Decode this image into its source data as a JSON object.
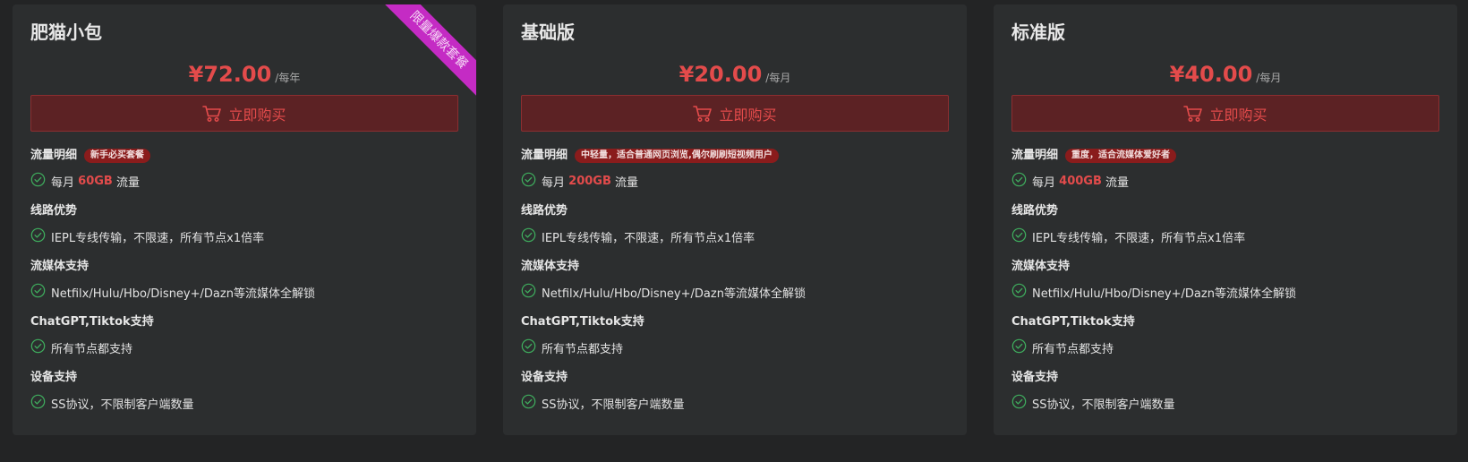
{
  "buy_label": "立即购买",
  "plans": [
    {
      "name": "肥猫小包",
      "price": "¥72.00",
      "period": "/每年",
      "ribbon": "限量爆款套餐",
      "traffic_title": "流量明细",
      "traffic_tag": "新手必买套餐",
      "traffic_prefix": "每月",
      "traffic_amount": "60GB",
      "traffic_suffix": "流量",
      "route_title": "线路优势",
      "route_text": "IEPL专线传输，不限速，所有节点x1倍率",
      "stream_title": "流媒体支持",
      "stream_text": "Netfilx/Hulu/Hbo/Disney+/Dazn等流媒体全解锁",
      "ai_title": "ChatGPT,Tiktok支持",
      "ai_text": "所有节点都支持",
      "device_title": "设备支持",
      "device_text": "SS协议，不限制客户端数量"
    },
    {
      "name": "基础版",
      "price": "¥20.00",
      "period": "/每月",
      "traffic_title": "流量明细",
      "traffic_tag": "中轻量，适合普通网页浏览,偶尔刷刷短视频用户",
      "traffic_prefix": "每月",
      "traffic_amount": "200GB",
      "traffic_suffix": "流量",
      "route_title": "线路优势",
      "route_text": "IEPL专线传输，不限速，所有节点x1倍率",
      "stream_title": "流媒体支持",
      "stream_text": "Netfilx/Hulu/Hbo/Disney+/Dazn等流媒体全解锁",
      "ai_title": "ChatGPT,Tiktok支持",
      "ai_text": "所有节点都支持",
      "device_title": "设备支持",
      "device_text": "SS协议，不限制客户端数量"
    },
    {
      "name": "标准版",
      "price": "¥40.00",
      "period": "/每月",
      "traffic_title": "流量明细",
      "traffic_tag": "重度，适合流媒体爱好者",
      "traffic_prefix": "每月",
      "traffic_amount": "400GB",
      "traffic_suffix": "流量",
      "route_title": "线路优势",
      "route_text": "IEPL专线传输，不限速，所有节点x1倍率",
      "stream_title": "流媒体支持",
      "stream_text": "Netfilx/Hulu/Hbo/Disney+/Dazn等流媒体全解锁",
      "ai_title": "ChatGPT,Tiktok支持",
      "ai_text": "所有节点都支持",
      "device_title": "设备支持",
      "device_text": "SS协议，不限制客户端数量"
    }
  ],
  "colors": {
    "background": "#232425",
    "card": "#2c2e2f",
    "accent_red": "#e34b4b",
    "button_bg": "#5c2224",
    "tag_bg": "#8a1c1c",
    "ribbon": "#c42bc4",
    "check": "#3fae5e"
  },
  "icons": {
    "cart": "cart-icon",
    "check": "check-circle-icon"
  }
}
